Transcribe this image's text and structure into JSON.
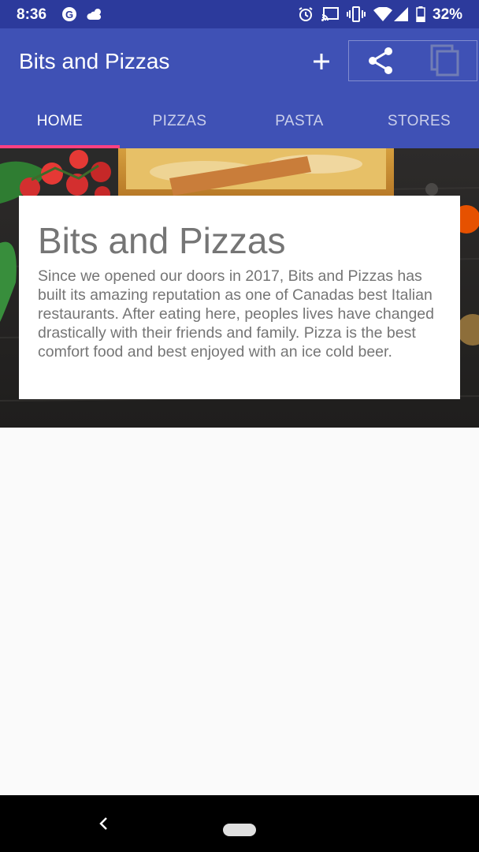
{
  "status_bar": {
    "time": "8:36",
    "battery_percent": "32%",
    "icons": [
      "g-app-icon",
      "cloud-weather-icon",
      "alarm-icon",
      "cast-icon",
      "vibrate-icon",
      "wifi-icon",
      "signal-icon",
      "battery-icon"
    ]
  },
  "app_bar": {
    "title": "Bits and Pizzas",
    "actions": [
      "add-icon",
      "share-icon",
      "copy-icon"
    ]
  },
  "tabs": [
    {
      "label": "HOME",
      "active": true
    },
    {
      "label": "PIZZAS",
      "active": false
    },
    {
      "label": "PASTA",
      "active": false
    },
    {
      "label": "STORES",
      "active": false
    }
  ],
  "card": {
    "title": "Bits and Pizzas",
    "body": "Since we opened our doors in 2017, Bits and Pizzas has built its amazing reputation as one of Canadas best Italian restaurants. After eating here, peoples lives have changed drastically with their friends and family. Pizza is the best comfort food and best enjoyed with an ice cold beer."
  },
  "colors": {
    "primary": "#3f51b5",
    "primary_dark": "#2c3a9c",
    "accent": "#ff4081"
  }
}
